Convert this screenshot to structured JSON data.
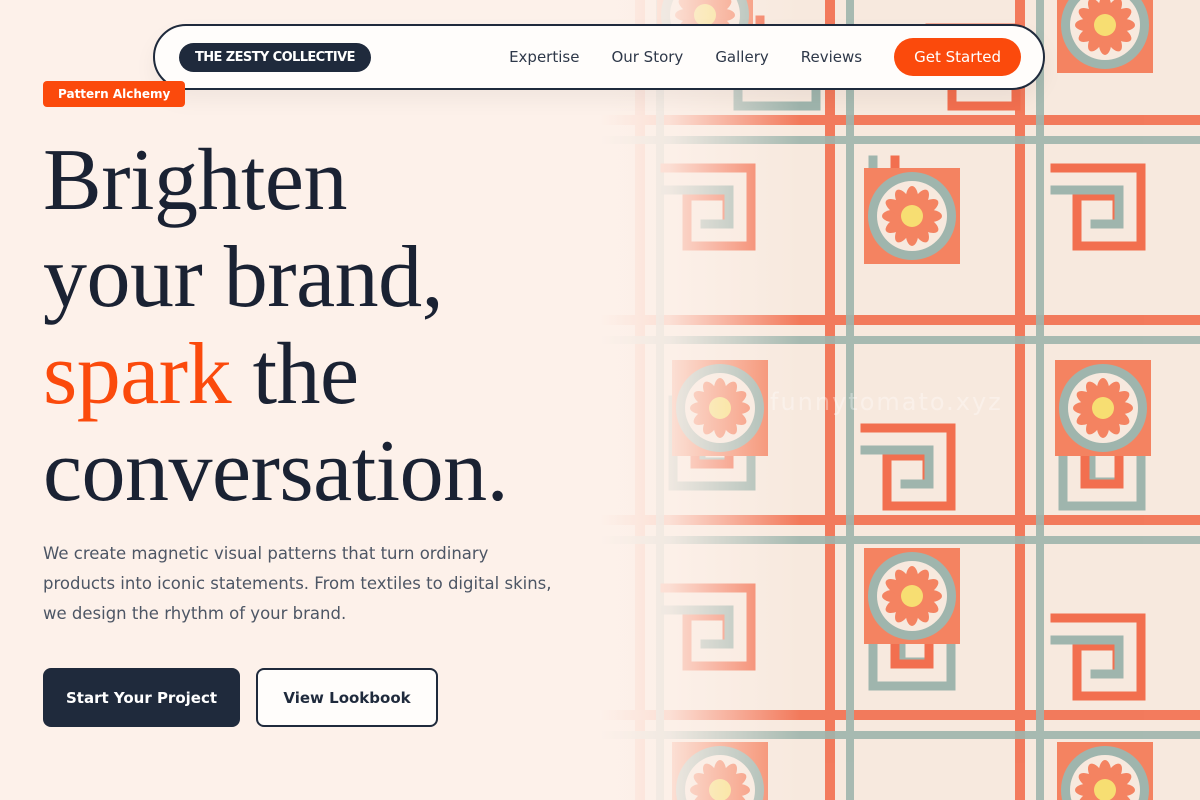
{
  "nav": {
    "logo": "THE ZESTY COLLECTIVE",
    "links": [
      "Expertise",
      "Our Story",
      "Gallery",
      "Reviews"
    ],
    "cta": "Get Started"
  },
  "hero": {
    "badge": "Pattern Alchemy",
    "headline": {
      "line1": "Brighten",
      "line2": "your brand,",
      "line3_accent": "spark",
      "line3_rest": " the",
      "line4": "conversation."
    },
    "description": "We create magnetic visual patterns that turn ordinary products into iconic statements. From textiles to digital skins, we design the rhythm of your brand.",
    "primary_button": "Start Your Project",
    "secondary_button": "View Lookbook"
  },
  "artwork": {
    "watermark": "funnytomato.xyz"
  },
  "colors": {
    "accent": "#fb4a0c",
    "navy": "#1f2a3c",
    "background": "#fdf1ea",
    "pattern_orange": "#f26f4f",
    "pattern_teal": "#9fb5ad",
    "pattern_yellow": "#f7de72"
  }
}
